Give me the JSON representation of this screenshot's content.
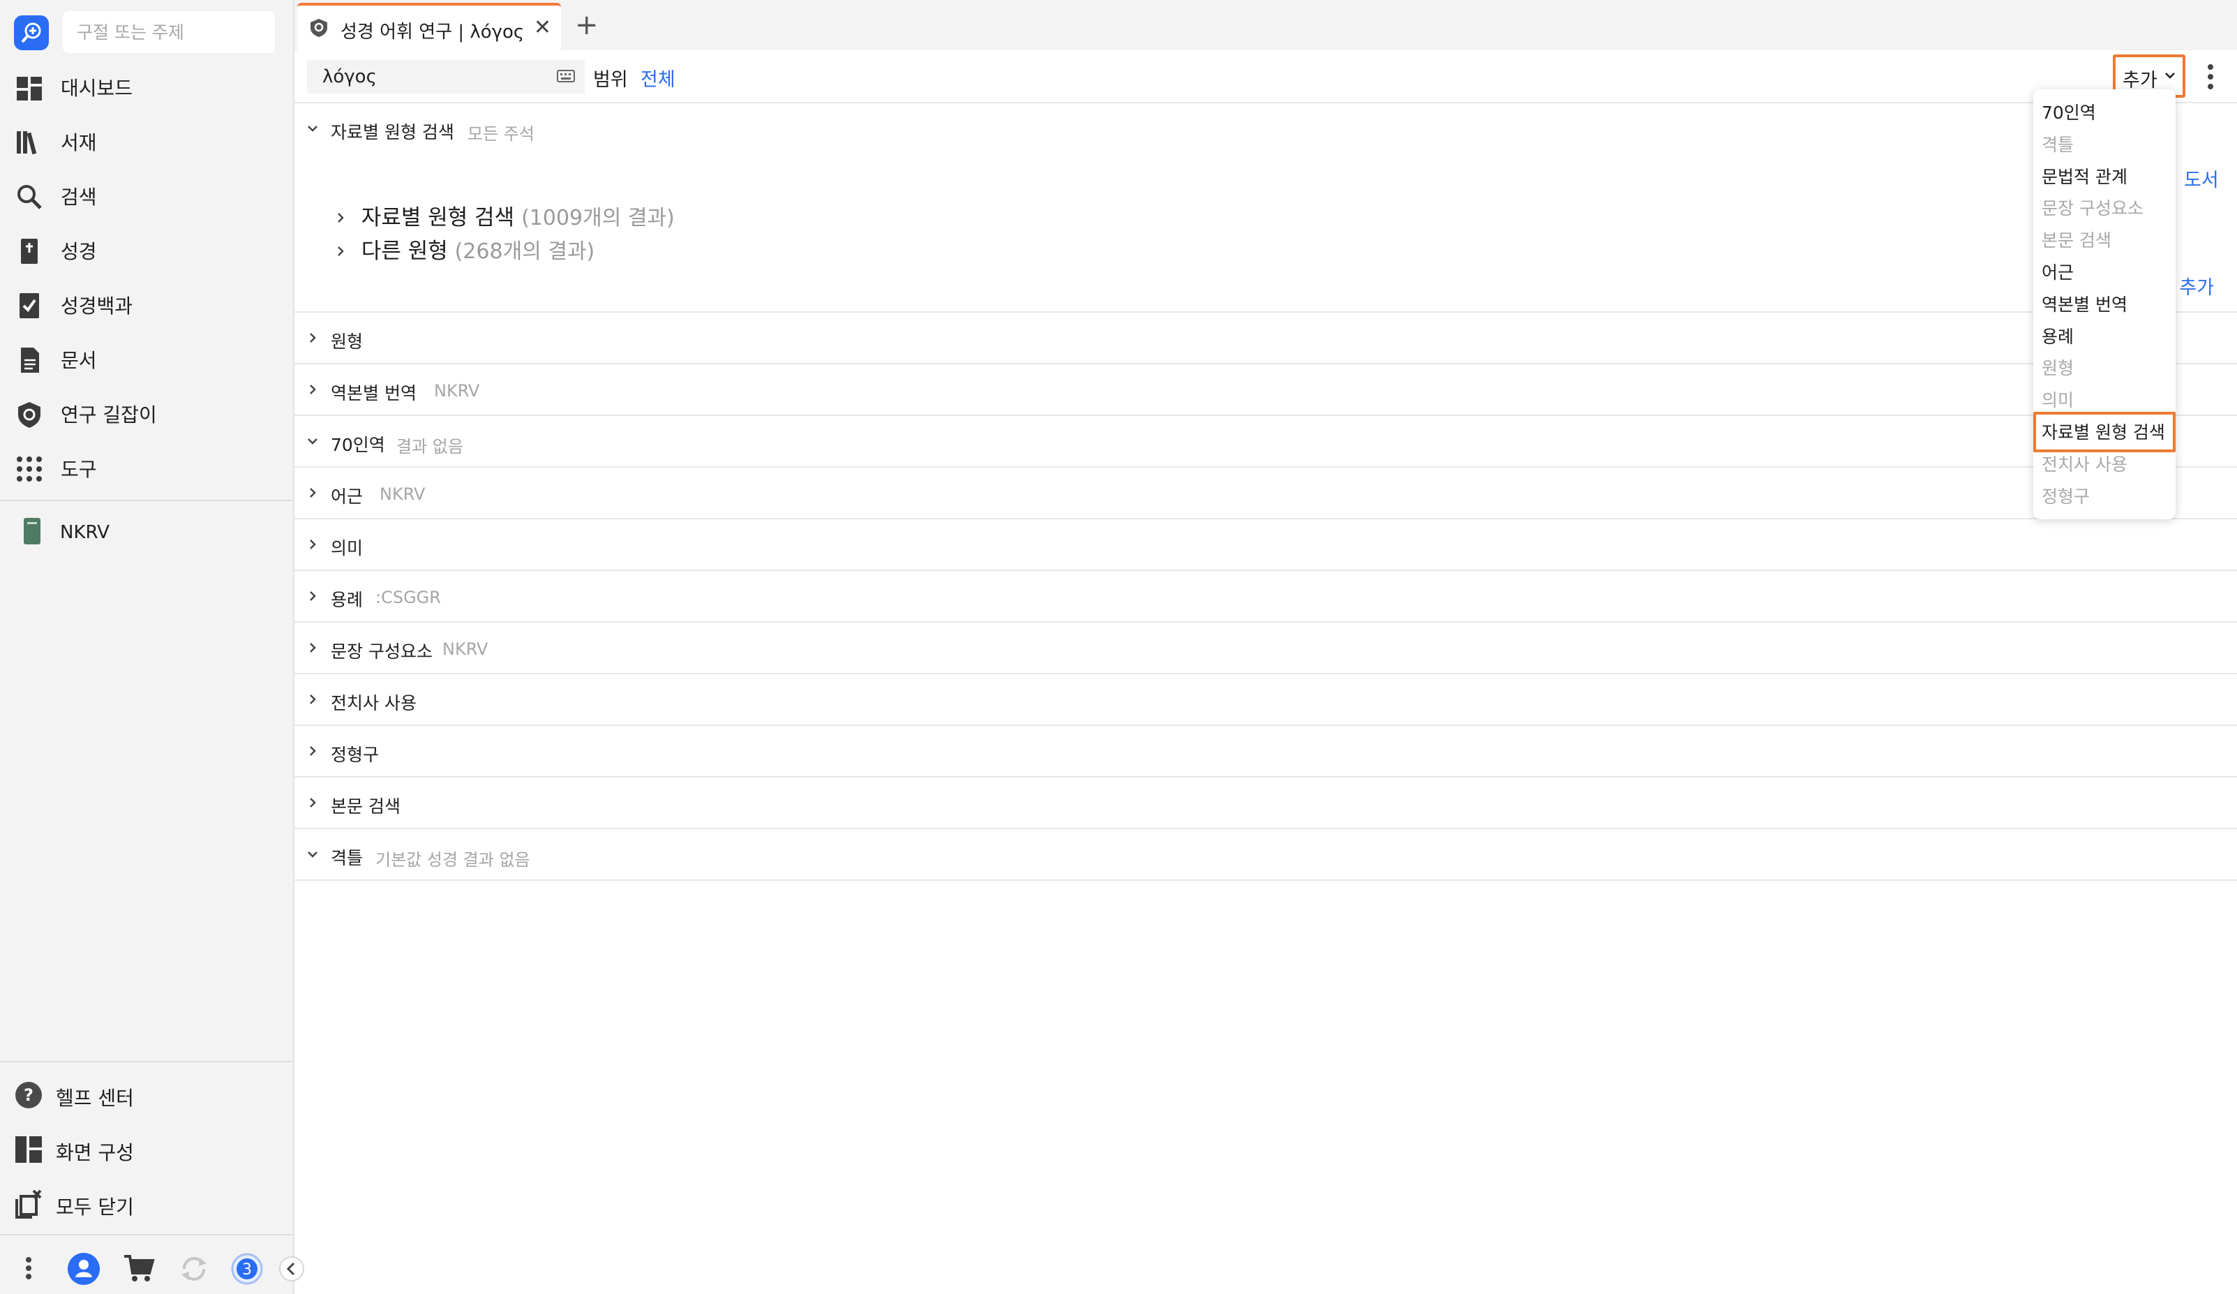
{
  "sidebar": {
    "search_placeholder": "구절 또는 주제",
    "nav_items": [
      {
        "label": "대시보드",
        "icon": "dashboard-icon"
      },
      {
        "label": "서재",
        "icon": "library-icon"
      },
      {
        "label": "검색",
        "icon": "search-icon"
      },
      {
        "label": "성경",
        "icon": "bible-icon"
      },
      {
        "label": "성경백과",
        "icon": "factbook-icon"
      },
      {
        "label": "문서",
        "icon": "document-icon"
      },
      {
        "label": "연구 길잡이",
        "icon": "guide-icon"
      },
      {
        "label": "도구",
        "icon": "tools-grid-icon"
      }
    ],
    "open_resource": "NKRV",
    "bottom_items": [
      {
        "label": "헬프 센터",
        "icon": "help-icon"
      },
      {
        "label": "화면 구성",
        "icon": "layout-icon"
      },
      {
        "label": "모두 닫기",
        "icon": "close-all-icon"
      }
    ],
    "sync_badge": "3"
  },
  "tab": {
    "title": "성경 어휘 연구 | λόγος"
  },
  "toolbar": {
    "lemma_value": "λόγος",
    "range_label": "범위",
    "range_value": "전체",
    "add_label": "추가"
  },
  "sections": {
    "expanded": {
      "title": "자료별 원형 검색",
      "sub": "모든 주석",
      "results": [
        {
          "label": "자료별 원형 검색",
          "count": "(1009개의 결과)"
        },
        {
          "label": "다른 원형",
          "count": "(268개의 결과)"
        }
      ]
    },
    "rows": [
      {
        "title": "원형",
        "sub": "",
        "expanded": false
      },
      {
        "title": "역본별 번역",
        "sub": "NKRV",
        "expanded": false
      },
      {
        "title": "70인역",
        "sub": "결과 없음",
        "expanded": true
      },
      {
        "title": "어근",
        "sub": "NKRV",
        "expanded": false
      },
      {
        "title": "의미",
        "sub": "",
        "expanded": false
      },
      {
        "title": "용례",
        "sub": ":CSGGR",
        "expanded": false
      },
      {
        "title": "문장 구성요소",
        "sub": "NKRV",
        "expanded": false
      },
      {
        "title": "전치사 사용",
        "sub": "",
        "expanded": false
      },
      {
        "title": "정형구",
        "sub": "",
        "expanded": false
      },
      {
        "title": "본문 검색",
        "sub": "",
        "expanded": false
      },
      {
        "title": "격틀",
        "sub": "기본값 성경 결과 없음",
        "expanded": true
      }
    ],
    "peek_links": [
      "도서",
      "! 추가"
    ]
  },
  "dropdown": {
    "items": [
      {
        "label": "70인역",
        "enabled": true
      },
      {
        "label": "격틀",
        "enabled": false
      },
      {
        "label": "문법적 관계",
        "enabled": true
      },
      {
        "label": "문장 구성요소",
        "enabled": false
      },
      {
        "label": "본문 검색",
        "enabled": false
      },
      {
        "label": "어근",
        "enabled": true
      },
      {
        "label": "역본별 번역",
        "enabled": true
      },
      {
        "label": "용례",
        "enabled": true
      },
      {
        "label": "원형",
        "enabled": false
      },
      {
        "label": "의미",
        "enabled": false
      },
      {
        "label": "자료별 원형 검색",
        "enabled": true,
        "highlighted": true
      },
      {
        "label": "전치사 사용",
        "enabled": false
      },
      {
        "label": "정형구",
        "enabled": false
      }
    ]
  },
  "colors": {
    "accent_orange": "#ee7a33",
    "link_blue": "#2a6df4",
    "sidebar_bg": "#f3f3f3",
    "muted_text": "#a6a6a6"
  }
}
